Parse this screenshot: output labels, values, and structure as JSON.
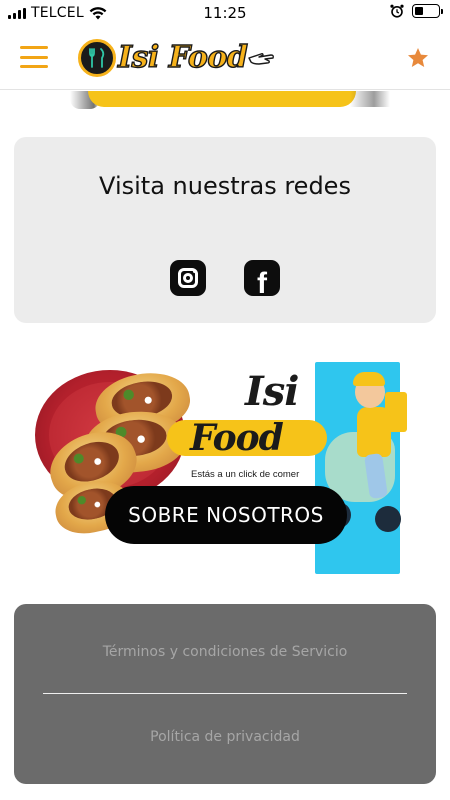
{
  "status_bar": {
    "carrier": "TELCEL",
    "time": "11:25",
    "battery_level": 0.35
  },
  "header": {
    "logo_text": "Isi Food",
    "menu_icon": "hamburger-icon",
    "favorite_icon": "star-icon"
  },
  "social": {
    "title": "Visita nuestras redes",
    "items": [
      {
        "icon": "instagram-icon"
      },
      {
        "icon": "facebook-icon",
        "glyph": "f"
      }
    ]
  },
  "promo": {
    "brand_line1": "Isi",
    "brand_line2": "Food",
    "tagline": "Estás a un click de comer",
    "button_label": "SOBRE NOSOTROS"
  },
  "footer": {
    "terms": "Términos y condiciones de Servicio",
    "privacy": "Política de privacidad"
  },
  "colors": {
    "accent": "#f2a515",
    "brand_yellow": "#f6c319",
    "card_bg": "#ececec",
    "footer_bg": "#6b6b6b",
    "star": "#e8893b"
  }
}
